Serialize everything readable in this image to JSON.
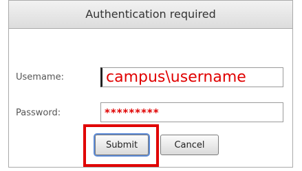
{
  "dialog": {
    "title": "Authentication required",
    "username_label": "Usemame:",
    "username_value": "campus\\username",
    "password_label": "Password:",
    "password_value": "*********",
    "submit_label": "Submit",
    "cancel_label": "Cancel"
  },
  "colors": {
    "highlight": "#e00000",
    "entered_text": "#e00000",
    "focus_ring": "#5b8ad6"
  }
}
